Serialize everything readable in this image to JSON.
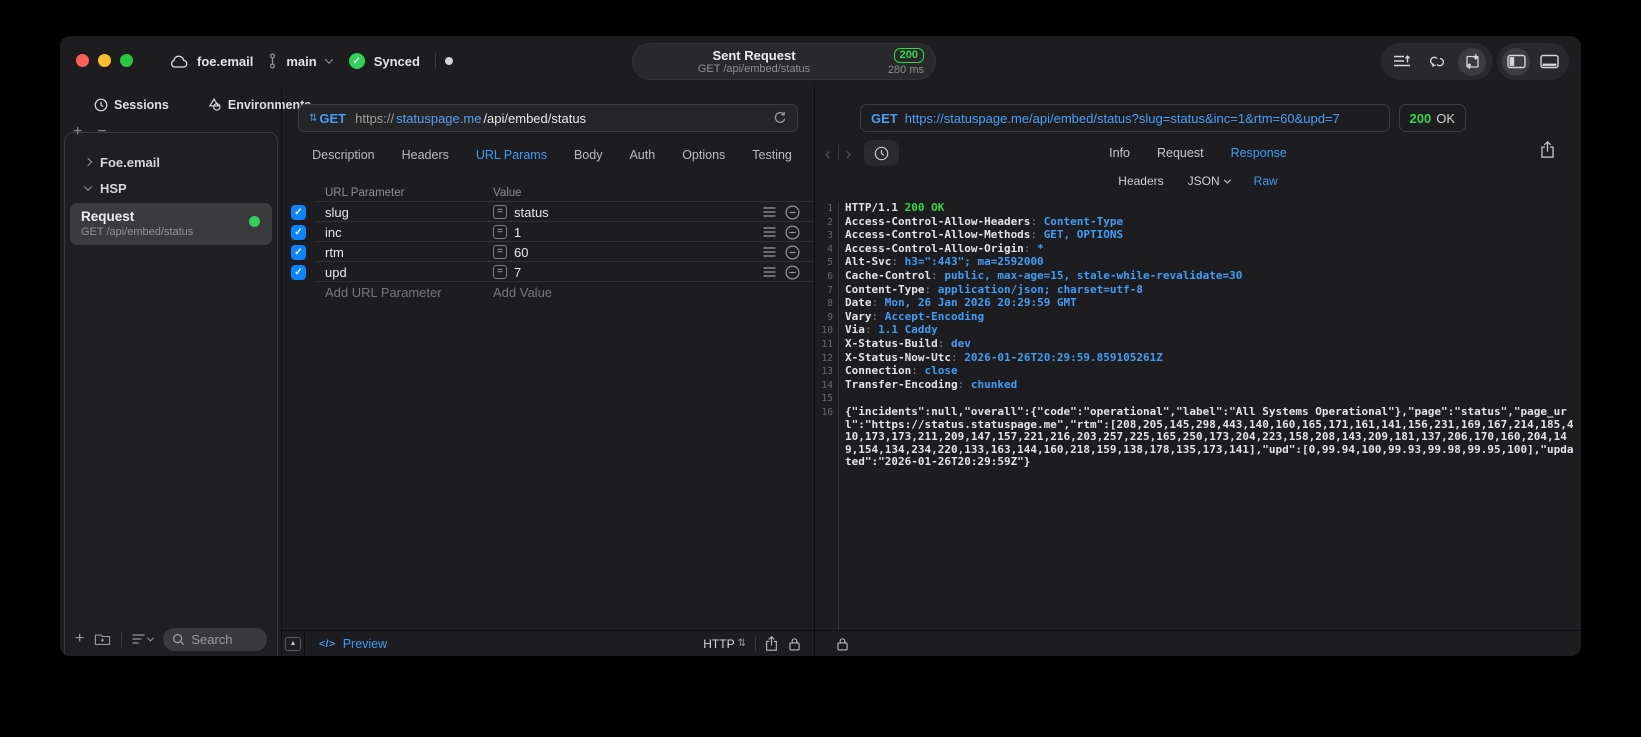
{
  "titlebar": {
    "project": "foe.email",
    "branch": "main",
    "sync_label": "Synced",
    "request_title": "Sent Request",
    "request_subtitle": "GET /api/embed/status",
    "status_code": "200",
    "duration": "280 ms"
  },
  "sidebar": {
    "tabs": [
      "Sessions",
      "Environments"
    ],
    "groups": [
      "Foe.email",
      "HSP"
    ],
    "request": {
      "title": "Request",
      "subtitle": "GET /api/embed/status"
    },
    "search_placeholder": "Search"
  },
  "editor": {
    "method": "GET",
    "url": {
      "scheme": "https://",
      "host": "statuspage.me",
      "path": "/api/embed/status"
    },
    "tabs": [
      "Description",
      "Headers",
      "URL Params",
      "Body",
      "Auth",
      "Options",
      "Testing"
    ],
    "active_tab": "URL Params",
    "params": {
      "col_name": "URL Parameter",
      "col_value": "Value",
      "rows": [
        {
          "name": "slug",
          "value": "status",
          "enabled": true
        },
        {
          "name": "inc",
          "value": "1",
          "enabled": true
        },
        {
          "name": "rtm",
          "value": "60",
          "enabled": true
        },
        {
          "name": "upd",
          "value": "7",
          "enabled": true
        }
      ],
      "add_name": "Add URL Parameter",
      "add_value": "Add Value"
    },
    "footer": {
      "code_glyph": "</>",
      "preview": "Preview",
      "protocol": "HTTP"
    }
  },
  "response": {
    "method": "GET",
    "url": "https://statuspage.me/api/embed/status?slug=status&inc=1&rtm=60&upd=7",
    "status_code": "200",
    "status_text": "OK",
    "tabs": [
      "Info",
      "Request",
      "Response"
    ],
    "active_tab": "Response",
    "subtabs": [
      "Headers",
      "JSON",
      "Raw"
    ],
    "active_subtab": "Raw",
    "status_line": {
      "version": "HTTP/1.1",
      "status": "200 OK"
    },
    "headers": [
      {
        "name": "Access-Control-Allow-Headers",
        "value": "Content-Type"
      },
      {
        "name": "Access-Control-Allow-Methods",
        "value": "GET, OPTIONS"
      },
      {
        "name": "Access-Control-Allow-Origin",
        "value": "*"
      },
      {
        "name": "Alt-Svc",
        "value": "h3=\":443\"; ma=2592000"
      },
      {
        "name": "Cache-Control",
        "value": "public, max-age=15, stale-while-revalidate=30"
      },
      {
        "name": "Content-Type",
        "value": "application/json; charset=utf-8"
      },
      {
        "name": "Date",
        "value": "Mon, 26 Jan 2026 20:29:59 GMT"
      },
      {
        "name": "Vary",
        "value": "Accept-Encoding"
      },
      {
        "name": "Via",
        "value": "1.1 Caddy"
      },
      {
        "name": "X-Status-Build",
        "value": "dev"
      },
      {
        "name": "X-Status-Now-Utc",
        "value": "2026-01-26T20:29:59.859105261Z"
      },
      {
        "name": "Connection",
        "value": "close"
      },
      {
        "name": "Transfer-Encoding",
        "value": "chunked"
      }
    ],
    "body_json": "{\"incidents\":null,\"overall\":{\"code\":\"operational\",\"label\":\"All Systems Operational\"},\"page\":\"status\",\"page_url\":\"https://status.statuspage.me\",\"rtm\":[208,205,145,298,443,140,160,165,171,161,141,156,231,169,167,214,185,410,173,173,211,209,147,157,221,216,203,257,225,165,250,173,204,223,158,208,143,209,181,137,206,170,160,204,149,154,134,234,220,133,163,144,160,218,159,138,178,135,173,141],\"upd\":[0,99.94,100,99.93,99.98,99.95,100],\"updated\":\"2026-01-26T20:29:59Z\"}",
    "colors": {
      "accent_blue": "#419cf7",
      "status_green": "#32d74b"
    }
  }
}
